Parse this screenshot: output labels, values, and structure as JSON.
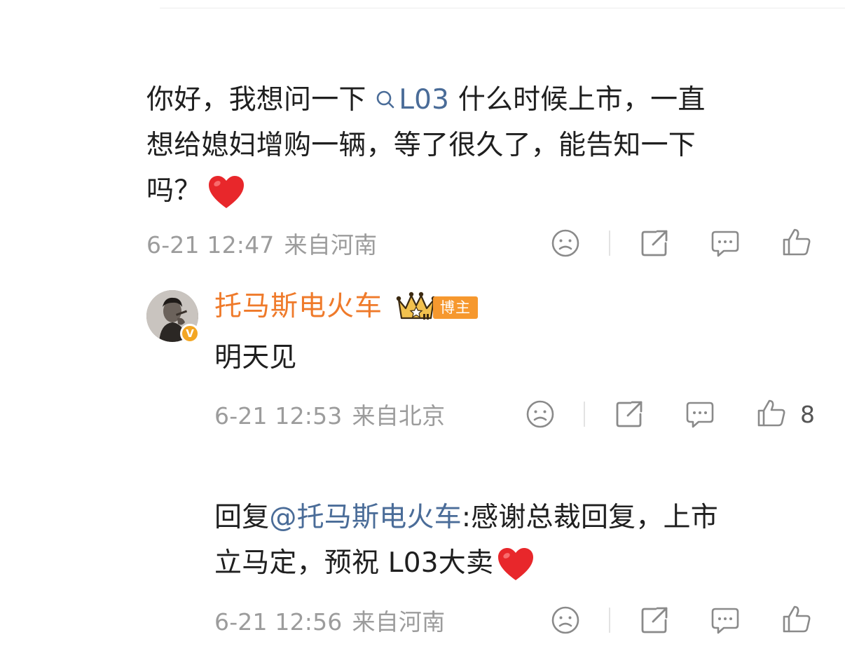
{
  "comment1": {
    "text_line1_before": "你好，我想问一下 ",
    "topic": "L03",
    "text_line1_after": " 什么时候上市，一直",
    "text_line2": "想给媳妇增购一辆，等了很久了，能告知一下",
    "text_line3": "吗？",
    "emoji": "heart-emoji",
    "date": "6-21 12:47",
    "location": "来自河南"
  },
  "reply1": {
    "author": "托马斯电火车",
    "verified_mark": "V",
    "badge": "博主",
    "text": "明天见",
    "date": "6-21 12:53",
    "location": "来自北京",
    "like_count": "8"
  },
  "reply2": {
    "prefix": "回复",
    "mention": "@托马斯电火车",
    "text_line1_after": ":感谢总裁回复，上市",
    "text_line2": "立马定，预祝 L03大卖",
    "emoji": "heart-emoji",
    "date": "6-21 12:56",
    "location": "来自河南"
  },
  "colors": {
    "link": "#4a6c98",
    "author": "#ef7a2a",
    "meta": "#9c9c9c",
    "badge": "#f6982e"
  },
  "icons": [
    "sad-face-icon",
    "share-icon",
    "comment-icon",
    "like-icon"
  ]
}
